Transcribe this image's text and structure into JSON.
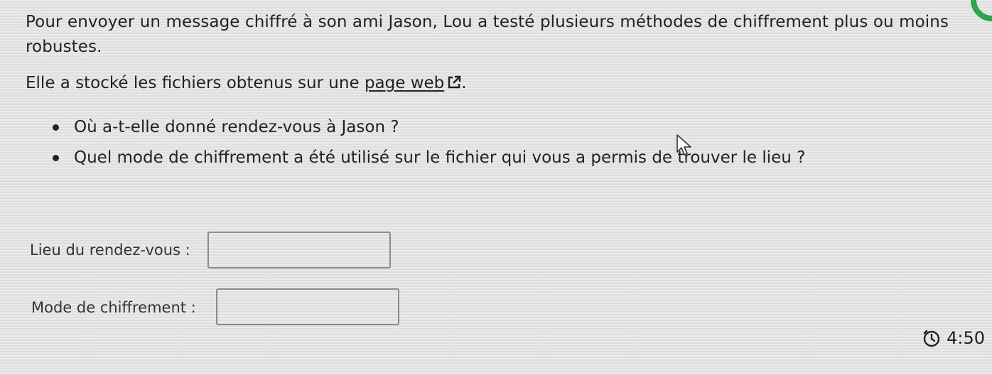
{
  "intro": {
    "paragraph1": "Pour envoyer un message chiffré à son ami Jason, Lou a testé plusieurs méthodes de chiffrement plus ou moins robustes.",
    "paragraph2_prefix": "Elle a stocké les fichiers obtenus sur une ",
    "link_text": "page web",
    "paragraph2_suffix": "."
  },
  "questions": [
    "Où a-t-elle donné rendez-vous à Jason ?",
    "Quel mode de chiffrement a été utilisé sur le fichier qui vous a permis de trouver le lieu ?"
  ],
  "fields": {
    "meeting_place": {
      "label": "Lieu du rendez-vous :",
      "value": ""
    },
    "cipher_mode": {
      "label": "Mode de chiffrement :",
      "value": ""
    }
  },
  "timer": {
    "time": "4:50"
  },
  "icons": {
    "external_link": "external-link-icon",
    "timer": "timer-icon",
    "corner": "progress-indicator-icon"
  },
  "colors": {
    "text": "#222222",
    "border": "#8a8a8a",
    "corner_accent": "#2ea44f"
  }
}
